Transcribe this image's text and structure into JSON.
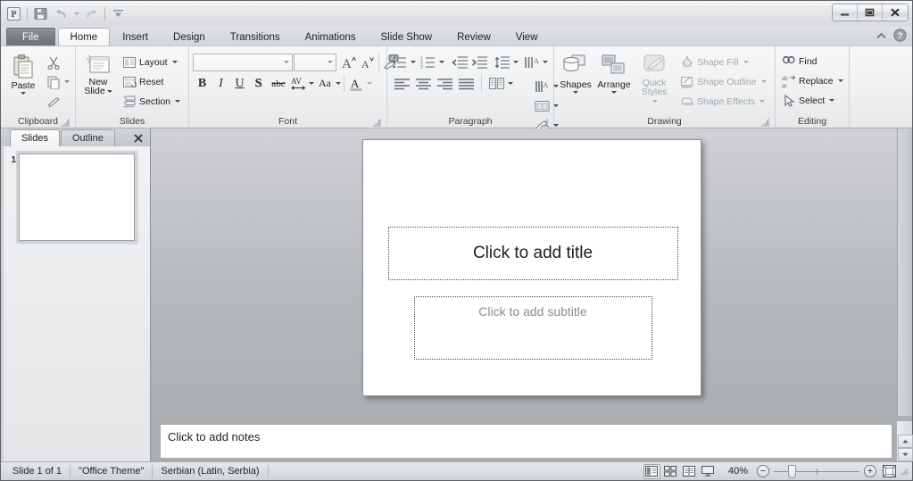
{
  "window": {
    "quick_access": [
      {
        "name": "powerpoint-logo-icon",
        "label": "P"
      },
      {
        "name": "save-icon",
        "label": "Save"
      },
      {
        "name": "undo-icon",
        "label": "Undo"
      },
      {
        "name": "redo-icon",
        "label": "Redo"
      },
      {
        "name": "customize-qat-icon",
        "label": "Customize Quick Access Toolbar"
      }
    ],
    "controls": {
      "minimize": "–",
      "maximize": "❐",
      "close": "✕"
    }
  },
  "ribbon": {
    "tabs": [
      {
        "label": "File",
        "active": false,
        "kind": "file"
      },
      {
        "label": "Home",
        "active": true,
        "kind": "normal"
      },
      {
        "label": "Insert",
        "active": false,
        "kind": "normal"
      },
      {
        "label": "Design",
        "active": false,
        "kind": "normal"
      },
      {
        "label": "Transitions",
        "active": false,
        "kind": "normal"
      },
      {
        "label": "Animations",
        "active": false,
        "kind": "normal"
      },
      {
        "label": "Slide Show",
        "active": false,
        "kind": "normal"
      },
      {
        "label": "Review",
        "active": false,
        "kind": "normal"
      },
      {
        "label": "View",
        "active": false,
        "kind": "normal"
      }
    ],
    "corner": {
      "minimize_ribbon": "collapse-ribbon-icon",
      "help": "?"
    },
    "groups": {
      "clipboard": {
        "label": "Clipboard",
        "paste": "Paste",
        "cut": "Cut",
        "copy": "Copy",
        "format_painter": "Format Painter"
      },
      "slides": {
        "label": "Slides",
        "new_slide": "New\nSlide",
        "new_slide_line1": "New",
        "new_slide_line2": "Slide",
        "layout": "Layout",
        "reset": "Reset",
        "section": "Section"
      },
      "font": {
        "label": "Font",
        "font_name_value": "",
        "font_size_value": "",
        "grow_font": "Increase Font Size",
        "shrink_font": "Decrease Font Size",
        "clear_formatting": "Clear All Formatting",
        "bold": "B",
        "italic": "I",
        "underline": "U",
        "shadow": "S",
        "strikethrough": "abc",
        "character_spacing": "AV",
        "change_case": "Aa",
        "font_color": "A"
      },
      "paragraph": {
        "label": "Paragraph",
        "bullets": "Bullets",
        "numbering": "Numbering",
        "decrease_indent": "Decrease List Level",
        "increase_indent": "Increase List Level",
        "line_spacing": "Line Spacing",
        "text_direction": "Text Direction",
        "align_text": "Align Text",
        "convert_smartart": "Convert to SmartArt",
        "align_left": "Align Text Left",
        "center": "Center",
        "align_right": "Align Text Right",
        "justify": "Justify",
        "columns": "Columns"
      },
      "drawing": {
        "label": "Drawing",
        "shapes": "Shapes",
        "arrange": "Arrange",
        "quick_styles_line1": "Quick",
        "quick_styles_line2": "Styles",
        "shape_fill": "Shape Fill",
        "shape_outline": "Shape Outline",
        "shape_effects": "Shape Effects"
      },
      "editing": {
        "label": "Editing",
        "find": "Find",
        "replace": "Replace",
        "select": "Select"
      }
    }
  },
  "slide_pane": {
    "tabs": [
      {
        "label": "Slides",
        "active": true
      },
      {
        "label": "Outline",
        "active": false
      }
    ],
    "close": "✕",
    "thumbnails": [
      {
        "number": "1"
      }
    ]
  },
  "slide": {
    "title_placeholder": "Click to add title",
    "subtitle_placeholder": "Click to add subtitle"
  },
  "notes": {
    "placeholder": "Click to add notes"
  },
  "statusbar": {
    "slide_count": "Slide 1 of 1",
    "theme": "\"Office Theme\"",
    "language": "Serbian (Latin, Serbia)",
    "views": [
      {
        "name": "normal-view-icon",
        "label": "Normal",
        "active": true
      },
      {
        "name": "slide-sorter-icon",
        "label": "Slide Sorter",
        "active": false
      },
      {
        "name": "reading-view-icon",
        "label": "Reading View",
        "active": false
      },
      {
        "name": "slide-show-icon",
        "label": "Slide Show",
        "active": false
      }
    ],
    "zoom_level": "40%",
    "zoom_out": "−",
    "zoom_in": "+",
    "fit_to_window": "Fit slide to current window"
  },
  "colors": {
    "accent": "#7a8189",
    "slide_bg": "#ffffff",
    "placeholder_text": "#8c8c8c",
    "chrome": "#d3d6d9"
  }
}
